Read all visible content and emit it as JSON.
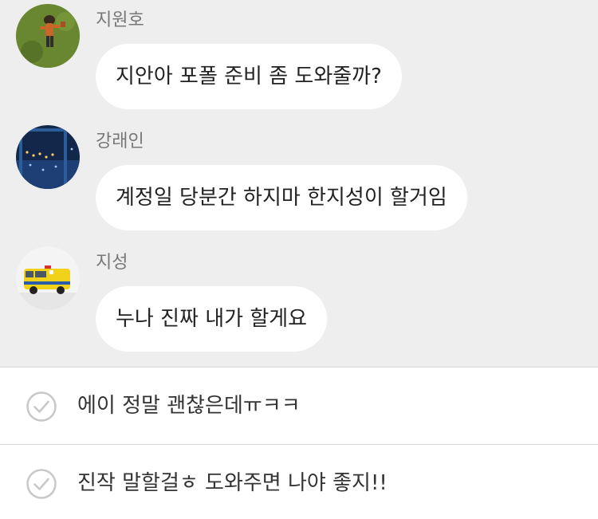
{
  "messages": [
    {
      "sender": "지원호",
      "text": "지안아 포폴 준비 좀 도와줄까?"
    },
    {
      "sender": "강래인",
      "text": "계정일 당분간 하지마 한지성이 할거임"
    },
    {
      "sender": "지성",
      "text": "누나 진짜 내가 할게요"
    }
  ],
  "replies": [
    {
      "text": "에이 정말 괜찮은데ㅠㅋㅋ"
    },
    {
      "text": "진작 말할걸ㅎ 도와주면 나야 좋지!!"
    }
  ],
  "colors": {
    "chat_background": "#eeeeee",
    "bubble": "#ffffff",
    "sender_text": "#777777",
    "check_icon": "#c8c8c8",
    "divider": "#d6d6d6"
  },
  "icons": {
    "avatar_1": "grass-avatar-photo",
    "avatar_2": "night-city-avatar-photo",
    "avatar_3": "ambulance-avatar-photo",
    "reply_check": "check-circle-icon"
  }
}
